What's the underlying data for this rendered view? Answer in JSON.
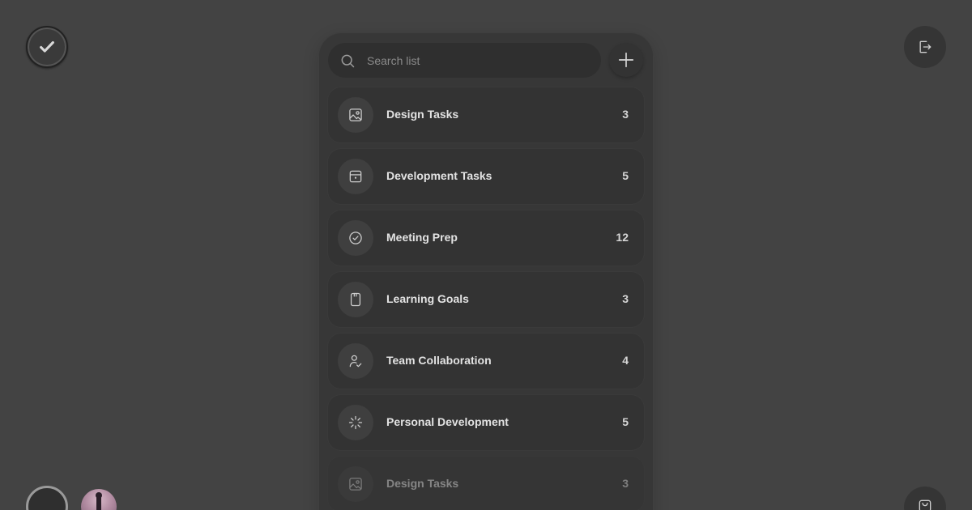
{
  "search": {
    "placeholder": "Search list"
  },
  "lists": [
    {
      "label": "Design Tasks",
      "count": "3",
      "icon": "image-icon"
    },
    {
      "label": "Development Tasks",
      "count": "5",
      "icon": "archive-icon"
    },
    {
      "label": "Meeting Prep",
      "count": "12",
      "icon": "check-circle-icon"
    },
    {
      "label": "Learning Goals",
      "count": "3",
      "icon": "sd-card-icon"
    },
    {
      "label": "Team Collaboration",
      "count": "4",
      "icon": "user-check-icon"
    },
    {
      "label": "Personal Development",
      "count": "5",
      "icon": "loader-icon"
    },
    {
      "label": "Design Tasks",
      "count": "3",
      "icon": "image-icon"
    }
  ],
  "colors": {
    "background": "#434343",
    "panel": "#373737",
    "item": "#333333"
  }
}
